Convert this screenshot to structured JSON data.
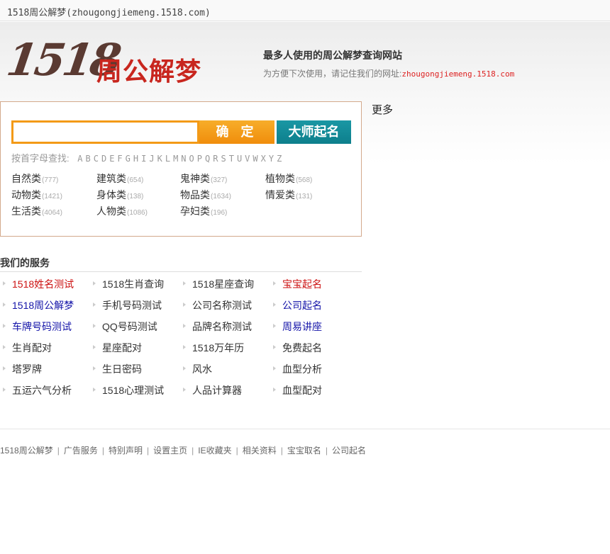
{
  "topbar": {
    "title": "1518周公解梦(zhougongjiemeng.1518.com)"
  },
  "logo": {
    "number": "1518",
    "text": "周公解梦"
  },
  "header": {
    "slogan": "最多人使用的周公解梦查询网站",
    "tip_prefix": "为方便下次使用，请记住我们的网址:",
    "tip_url": "zhougongjiemeng.1518.com"
  },
  "search": {
    "input_value": "",
    "button_ok": "确 定",
    "button_master": "大师起名",
    "alpha_label": "按首字母查找:",
    "letters": [
      "A",
      "B",
      "C",
      "D",
      "E",
      "F",
      "G",
      "H",
      "I",
      "J",
      "K",
      "L",
      "M",
      "N",
      "O",
      "P",
      "Q",
      "R",
      "S",
      "T",
      "U",
      "V",
      "W",
      "X",
      "Y",
      "Z"
    ]
  },
  "categories": [
    {
      "name": "自然类",
      "count": "(777)"
    },
    {
      "name": "建筑类",
      "count": "(654)"
    },
    {
      "name": "鬼神类",
      "count": "(327)"
    },
    {
      "name": "植物类",
      "count": "(568)"
    },
    {
      "name": "动物类",
      "count": "(1421)"
    },
    {
      "name": "身体类",
      "count": "(138)"
    },
    {
      "name": "物品类",
      "count": "(1634)"
    },
    {
      "name": "情爱类",
      "count": "(131)"
    },
    {
      "name": "生活类",
      "count": "(4064)"
    },
    {
      "name": "人物类",
      "count": "(1086)"
    },
    {
      "name": "孕妇类",
      "count": "(196)"
    }
  ],
  "more_label": "更多",
  "services": {
    "title": "我们的服务",
    "items": [
      {
        "label": "1518姓名测试",
        "color": "red"
      },
      {
        "label": "1518生肖查询",
        "color": "dark"
      },
      {
        "label": "1518星座查询",
        "color": "dark"
      },
      {
        "label": "宝宝起名",
        "color": "red"
      },
      {
        "label": "1518周公解梦",
        "color": "blue"
      },
      {
        "label": "手机号码测试",
        "color": "dark"
      },
      {
        "label": "公司名称测试",
        "color": "dark"
      },
      {
        "label": "公司起名",
        "color": "blue"
      },
      {
        "label": "车牌号码测试",
        "color": "blue"
      },
      {
        "label": "QQ号码测试",
        "color": "dark"
      },
      {
        "label": "品牌名称测试",
        "color": "dark"
      },
      {
        "label": "周易讲座",
        "color": "blue"
      },
      {
        "label": "生肖配对",
        "color": "dark"
      },
      {
        "label": "星座配对",
        "color": "dark"
      },
      {
        "label": "1518万年历",
        "color": "dark"
      },
      {
        "label": "免费起名",
        "color": "dark"
      },
      {
        "label": "塔罗牌",
        "color": "dark"
      },
      {
        "label": "生日密码",
        "color": "dark"
      },
      {
        "label": "风水",
        "color": "dark"
      },
      {
        "label": "血型分析",
        "color": "dark"
      },
      {
        "label": "五运六气分析",
        "color": "dark"
      },
      {
        "label": "1518心理测试",
        "color": "dark"
      },
      {
        "label": "人品计算器",
        "color": "dark"
      },
      {
        "label": "血型配对",
        "color": "dark"
      }
    ]
  },
  "footer": {
    "links": [
      "1518周公解梦",
      "广告服务",
      "特别声明",
      "设置主页",
      "IE收藏夹",
      "相关资料",
      "宝宝取名",
      "公司起名"
    ],
    "separator": "|"
  }
}
